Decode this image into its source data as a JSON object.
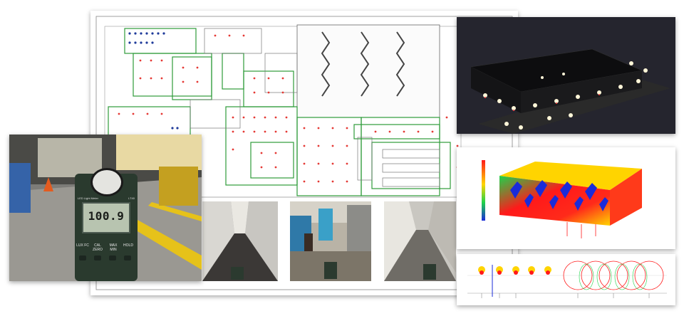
{
  "meter": {
    "brand": "LED Light Meter",
    "model": "LT40",
    "reading": "100.9",
    "buttons": [
      "LUX FC",
      "CAL ZERO",
      "MAX MIN",
      "HOLD"
    ]
  },
  "colors": {
    "floorplan_walls": "#2e9b3a",
    "fixture_red": "#e53935",
    "fixture_blue": "#1e3a9a",
    "render_bg": "#25252e",
    "heatmap_hot": "#ff1a1a",
    "heatmap_warm": "#ffd400",
    "heatmap_cool": "#1fd34a"
  },
  "icons": {
    "legend": "color-scale-legend"
  }
}
